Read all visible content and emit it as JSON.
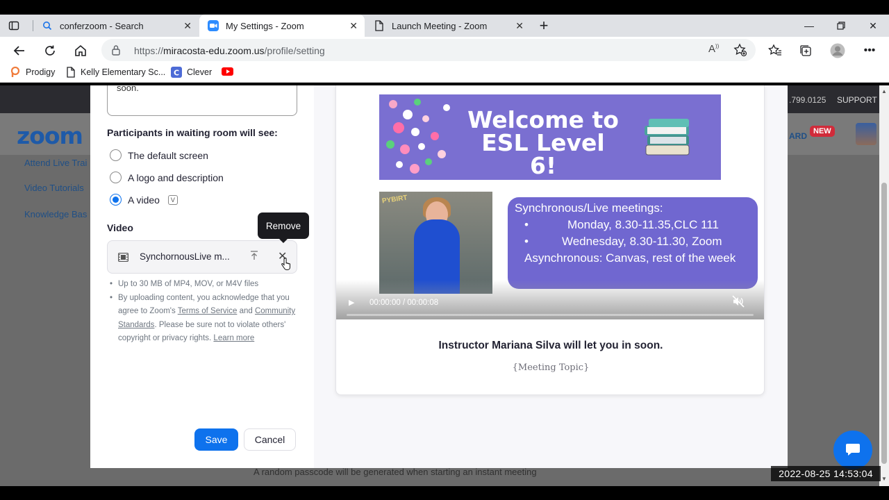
{
  "browser": {
    "tabs": [
      {
        "title": "conferzoom - Search"
      },
      {
        "title": "My Settings - Zoom"
      },
      {
        "title": "Launch Meeting - Zoom"
      }
    ],
    "url_domain": "miracosta-edu.zoom.us",
    "url_scheme": "https://",
    "url_path": "/profile/setting",
    "bookmarks": [
      {
        "label": "Prodigy"
      },
      {
        "label": "Kelly Elementary Sc..."
      },
      {
        "label": "Clever"
      }
    ]
  },
  "background_page": {
    "logo": "zoom",
    "phone": ".799.0125",
    "support": "SUPPORT",
    "board": "ARD",
    "new_badge": "NEW",
    "side_links": [
      "Attend Live Trai",
      "Video Tutorials",
      "Knowledge Bas"
    ],
    "passcode_note": "A random passcode will be generated when starting an instant meeting"
  },
  "modal": {
    "textarea_tail": "soon.",
    "waiting_room_label": "Participants in waiting room will see:",
    "options": [
      {
        "label": "The default screen",
        "checked": false
      },
      {
        "label": "A logo and description",
        "checked": false
      },
      {
        "label": "A video",
        "checked": true
      }
    ],
    "video_badge": "V",
    "video_label": "Video",
    "video_file_name": "SynchornousLive m...",
    "tooltip": "Remove",
    "notes": {
      "size_limit": "Up to 30 MB of MP4, MOV, or M4V files",
      "upload_prefix": "By uploading content, you acknowledge that you agree to Zoom's ",
      "terms_link": "Terms of Service",
      "and": " and ",
      "community_link": "Community Standards",
      "upload_suffix": ". Please be sure not to violate others' copyright or privacy rights. ",
      "learn_more": "Learn more"
    },
    "save_label": "Save",
    "cancel_label": "Cancel"
  },
  "preview": {
    "banner_line1": "Welcome to",
    "banner_line2": "ESL Level 6!",
    "photo_banner": "PYBIRT",
    "schedule_title": "Synchronous/Live meetings:",
    "schedule_items": [
      "Monday, 8.30-11.35,CLC 111",
      "Wednesday, 8.30-11.30, Zoom"
    ],
    "schedule_async": "Asynchronous: Canvas, rest of the week",
    "timecode": "00:00:00 / 00:00:08",
    "instructor_msg": "Instructor Mariana Silva will let you in soon.",
    "topic": "{Meeting Topic}"
  },
  "overlay": {
    "timestamp": "2022-08-25  14:53:04"
  },
  "colors": {
    "zoom_blue": "#0e72ed",
    "banner_purple": "#7a6fd1",
    "schedule_purple": "#7067d0"
  }
}
